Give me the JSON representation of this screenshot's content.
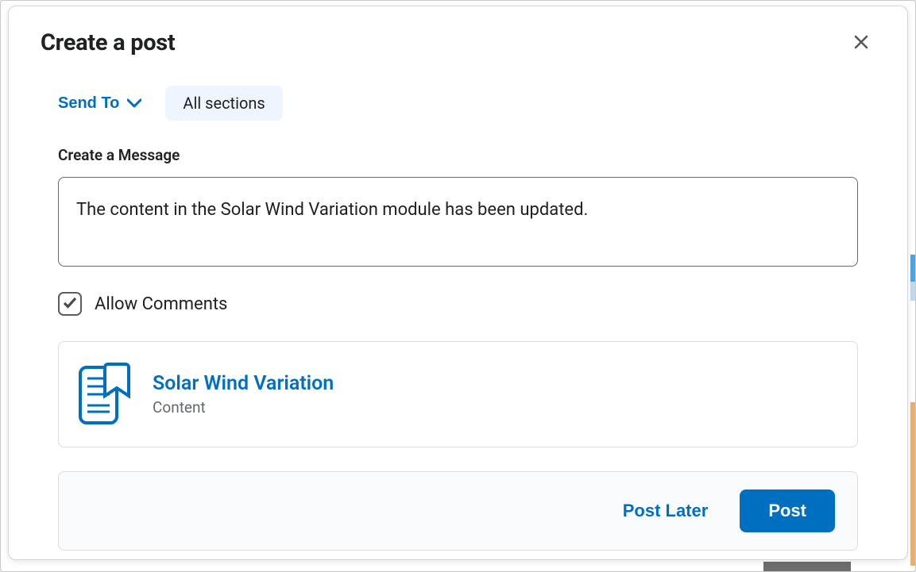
{
  "dialog": {
    "title": "Create a post"
  },
  "sendTo": {
    "label": "Send To",
    "chip": "All sections"
  },
  "message": {
    "label": "Create a Message",
    "value": "The content in the Solar Wind Variation module has been updated."
  },
  "allowComments": {
    "label": "Allow Comments",
    "checked": true
  },
  "attachment": {
    "title": "Solar Wind Variation",
    "type": "Content"
  },
  "actions": {
    "postLater": "Post Later",
    "post": "Post"
  }
}
